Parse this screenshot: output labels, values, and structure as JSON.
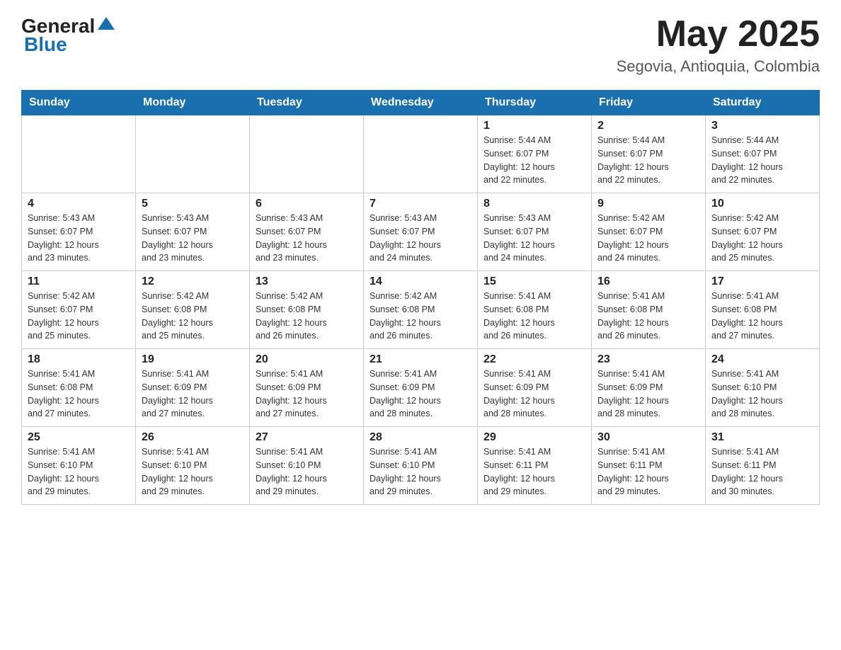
{
  "header": {
    "logo_general": "General",
    "logo_blue": "Blue",
    "month_year": "May 2025",
    "location": "Segovia, Antioquia, Colombia"
  },
  "days_of_week": [
    "Sunday",
    "Monday",
    "Tuesday",
    "Wednesday",
    "Thursday",
    "Friday",
    "Saturday"
  ],
  "weeks": [
    [
      {
        "num": "",
        "info": ""
      },
      {
        "num": "",
        "info": ""
      },
      {
        "num": "",
        "info": ""
      },
      {
        "num": "",
        "info": ""
      },
      {
        "num": "1",
        "info": "Sunrise: 5:44 AM\nSunset: 6:07 PM\nDaylight: 12 hours\nand 22 minutes."
      },
      {
        "num": "2",
        "info": "Sunrise: 5:44 AM\nSunset: 6:07 PM\nDaylight: 12 hours\nand 22 minutes."
      },
      {
        "num": "3",
        "info": "Sunrise: 5:44 AM\nSunset: 6:07 PM\nDaylight: 12 hours\nand 22 minutes."
      }
    ],
    [
      {
        "num": "4",
        "info": "Sunrise: 5:43 AM\nSunset: 6:07 PM\nDaylight: 12 hours\nand 23 minutes."
      },
      {
        "num": "5",
        "info": "Sunrise: 5:43 AM\nSunset: 6:07 PM\nDaylight: 12 hours\nand 23 minutes."
      },
      {
        "num": "6",
        "info": "Sunrise: 5:43 AM\nSunset: 6:07 PM\nDaylight: 12 hours\nand 23 minutes."
      },
      {
        "num": "7",
        "info": "Sunrise: 5:43 AM\nSunset: 6:07 PM\nDaylight: 12 hours\nand 24 minutes."
      },
      {
        "num": "8",
        "info": "Sunrise: 5:43 AM\nSunset: 6:07 PM\nDaylight: 12 hours\nand 24 minutes."
      },
      {
        "num": "9",
        "info": "Sunrise: 5:42 AM\nSunset: 6:07 PM\nDaylight: 12 hours\nand 24 minutes."
      },
      {
        "num": "10",
        "info": "Sunrise: 5:42 AM\nSunset: 6:07 PM\nDaylight: 12 hours\nand 25 minutes."
      }
    ],
    [
      {
        "num": "11",
        "info": "Sunrise: 5:42 AM\nSunset: 6:07 PM\nDaylight: 12 hours\nand 25 minutes."
      },
      {
        "num": "12",
        "info": "Sunrise: 5:42 AM\nSunset: 6:08 PM\nDaylight: 12 hours\nand 25 minutes."
      },
      {
        "num": "13",
        "info": "Sunrise: 5:42 AM\nSunset: 6:08 PM\nDaylight: 12 hours\nand 26 minutes."
      },
      {
        "num": "14",
        "info": "Sunrise: 5:42 AM\nSunset: 6:08 PM\nDaylight: 12 hours\nand 26 minutes."
      },
      {
        "num": "15",
        "info": "Sunrise: 5:41 AM\nSunset: 6:08 PM\nDaylight: 12 hours\nand 26 minutes."
      },
      {
        "num": "16",
        "info": "Sunrise: 5:41 AM\nSunset: 6:08 PM\nDaylight: 12 hours\nand 26 minutes."
      },
      {
        "num": "17",
        "info": "Sunrise: 5:41 AM\nSunset: 6:08 PM\nDaylight: 12 hours\nand 27 minutes."
      }
    ],
    [
      {
        "num": "18",
        "info": "Sunrise: 5:41 AM\nSunset: 6:08 PM\nDaylight: 12 hours\nand 27 minutes."
      },
      {
        "num": "19",
        "info": "Sunrise: 5:41 AM\nSunset: 6:09 PM\nDaylight: 12 hours\nand 27 minutes."
      },
      {
        "num": "20",
        "info": "Sunrise: 5:41 AM\nSunset: 6:09 PM\nDaylight: 12 hours\nand 27 minutes."
      },
      {
        "num": "21",
        "info": "Sunrise: 5:41 AM\nSunset: 6:09 PM\nDaylight: 12 hours\nand 28 minutes."
      },
      {
        "num": "22",
        "info": "Sunrise: 5:41 AM\nSunset: 6:09 PM\nDaylight: 12 hours\nand 28 minutes."
      },
      {
        "num": "23",
        "info": "Sunrise: 5:41 AM\nSunset: 6:09 PM\nDaylight: 12 hours\nand 28 minutes."
      },
      {
        "num": "24",
        "info": "Sunrise: 5:41 AM\nSunset: 6:10 PM\nDaylight: 12 hours\nand 28 minutes."
      }
    ],
    [
      {
        "num": "25",
        "info": "Sunrise: 5:41 AM\nSunset: 6:10 PM\nDaylight: 12 hours\nand 29 minutes."
      },
      {
        "num": "26",
        "info": "Sunrise: 5:41 AM\nSunset: 6:10 PM\nDaylight: 12 hours\nand 29 minutes."
      },
      {
        "num": "27",
        "info": "Sunrise: 5:41 AM\nSunset: 6:10 PM\nDaylight: 12 hours\nand 29 minutes."
      },
      {
        "num": "28",
        "info": "Sunrise: 5:41 AM\nSunset: 6:10 PM\nDaylight: 12 hours\nand 29 minutes."
      },
      {
        "num": "29",
        "info": "Sunrise: 5:41 AM\nSunset: 6:11 PM\nDaylight: 12 hours\nand 29 minutes."
      },
      {
        "num": "30",
        "info": "Sunrise: 5:41 AM\nSunset: 6:11 PM\nDaylight: 12 hours\nand 29 minutes."
      },
      {
        "num": "31",
        "info": "Sunrise: 5:41 AM\nSunset: 6:11 PM\nDaylight: 12 hours\nand 30 minutes."
      }
    ]
  ]
}
